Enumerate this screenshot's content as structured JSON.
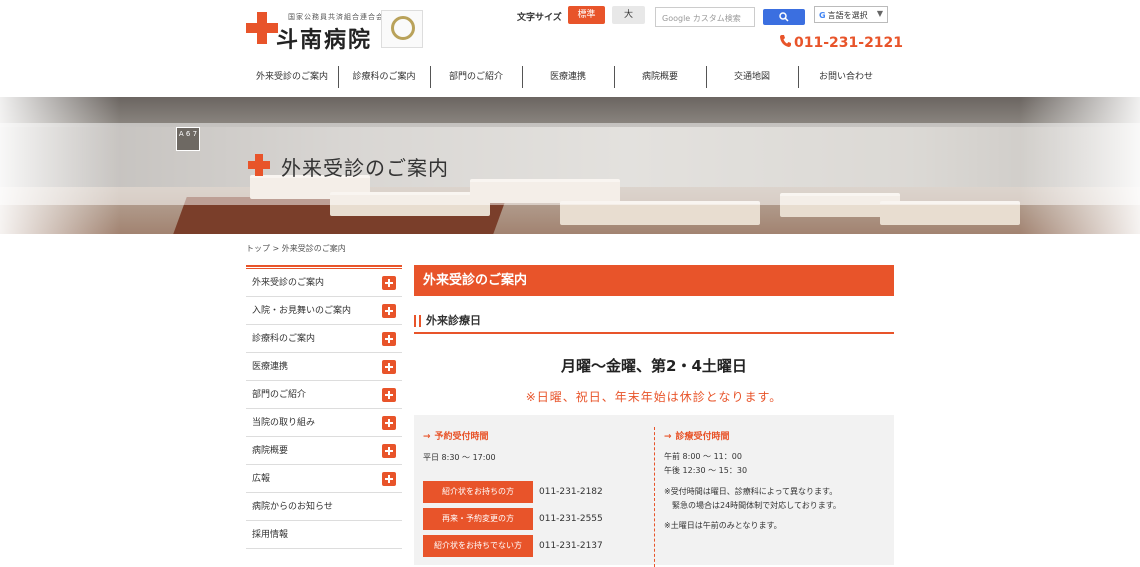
{
  "header": {
    "logo_sub": "国家公務員共済組合連合会",
    "logo_name": "斗南病院",
    "font_size_label": "文字サイズ",
    "font_size_standard": "標準",
    "font_size_large": "大",
    "search_placeholder": "Google カスタム検索",
    "language_label": "言語を選択",
    "language_g": "G",
    "language_arrow": "▼",
    "phone": "011-231-2121"
  },
  "nav": {
    "items": [
      {
        "label": "外来受診のご案内"
      },
      {
        "label": "診療科のご案内"
      },
      {
        "label": "部門のご紹介"
      },
      {
        "label": "医療連携"
      },
      {
        "label": "病院概要"
      },
      {
        "label": "交通地図"
      },
      {
        "label": "お問い合わせ"
      }
    ]
  },
  "hero": {
    "title": "外来受診のご案内",
    "sign": "A 6 7"
  },
  "breadcrumb": "トップ > 外来受診のご案内",
  "sidebar": {
    "items": [
      {
        "label": "外来受診のご案内",
        "expandable": true
      },
      {
        "label": "入院・お見舞いのご案内",
        "expandable": true
      },
      {
        "label": "診療科のご案内",
        "expandable": true
      },
      {
        "label": "医療連携",
        "expandable": true
      },
      {
        "label": "部門のご紹介",
        "expandable": true
      },
      {
        "label": "当院の取り組み",
        "expandable": true
      },
      {
        "label": "病院概要",
        "expandable": true
      },
      {
        "label": "広報",
        "expandable": true
      },
      {
        "label": "病院からのお知らせ",
        "expandable": false
      },
      {
        "label": "採用情報",
        "expandable": false
      }
    ]
  },
  "main": {
    "title": "外来受診のご案内",
    "section_title": "外来診療日",
    "days": "月曜〜金曜、第2・4土曜日",
    "closed_note": "※日曜、祝日、年末年始は休診となります。",
    "reservation": {
      "title": "予約受付時間",
      "hours": "平日 8:30 〜 17:00",
      "buttons": [
        {
          "label": "紹介状をお持ちの方",
          "tel": "011-231-2182"
        },
        {
          "label": "再来・予約変更の方",
          "tel": "011-231-2555"
        },
        {
          "label": "紹介状をお持ちでない方",
          "tel": "011-231-2137"
        }
      ]
    },
    "consultation": {
      "title": "診療受付時間",
      "am": "午前 8:00 〜 11：00",
      "pm": "午後 12:30 〜 15：30",
      "note1": "※受付時間は曜日、診療科によって異なります。",
      "note2": "緊急の場合は24時間体制で対応しております。",
      "note3": "※土曜日は午前のみとなります。"
    }
  },
  "colors": {
    "accent": "#e8542a",
    "search_button": "#3b6fe0"
  }
}
